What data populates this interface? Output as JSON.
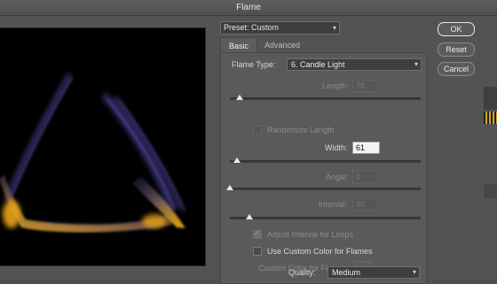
{
  "window": {
    "title": "Flame"
  },
  "preset": {
    "label": "Preset: Custom"
  },
  "tabs": [
    {
      "label": "Basic",
      "active": true
    },
    {
      "label": "Advanced",
      "active": false
    }
  ],
  "basic": {
    "flame_type": {
      "label": "Flame Type:",
      "value": "6. Candle Light"
    },
    "length": {
      "label": "Length:",
      "value": "78",
      "enabled": false,
      "slider_fraction": 0.05
    },
    "randomize_length": {
      "label": "Randomize Length",
      "checked": false,
      "enabled": false
    },
    "width": {
      "label": "Width:",
      "value": "61",
      "enabled": true,
      "slider_fraction": 0.05
    },
    "angle": {
      "label": "Angle:",
      "value": "0",
      "enabled": false,
      "slider_fraction": 0.0
    },
    "interval": {
      "label": "Interval:",
      "value": "30",
      "enabled": false,
      "slider_fraction": 0.12
    },
    "adjust_interval": {
      "label": "Adjust Interval for Loops",
      "checked": true,
      "enabled": false
    },
    "use_custom_color": {
      "label": "Use Custom Color for Flames",
      "checked": false,
      "enabled": true
    },
    "custom_color": {
      "label": "Custom Color for Flames:",
      "enabled": false
    },
    "quality": {
      "label": "Quality:",
      "value": "Medium"
    }
  },
  "buttons": {
    "ok": "OK",
    "reset": "Reset",
    "cancel": "Cancel"
  },
  "colors": {
    "flame_core": "#e0a020",
    "flame_glow": "#5a4aa0",
    "background": "#535353"
  }
}
